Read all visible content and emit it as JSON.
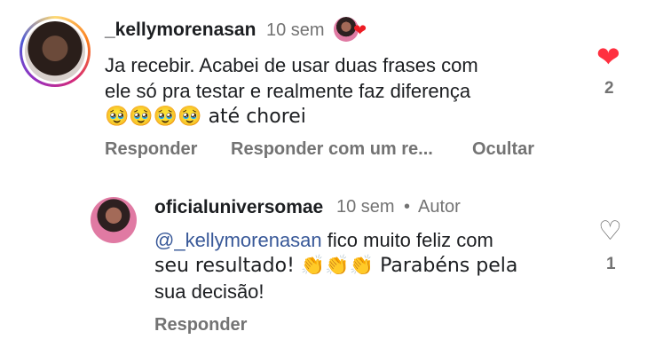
{
  "comments": [
    {
      "username": "_kellymorenasan",
      "time": "10 sem",
      "lines": [
        "Ja recebir. Acabei de usar duas frases com",
        "ele só pra testar e realmente faz diferença",
        "🥹🥹🥹🥹 até chorei"
      ],
      "actions": [
        "Responder",
        "Responder com um re...",
        "Ocultar"
      ],
      "likes": "2",
      "liked": true
    },
    {
      "username": "oficialuniversomae",
      "time": "10 sem",
      "separator": "•",
      "author_badge": "Autor",
      "mention": "@_kellymorenasan",
      "line1_rest": " fico muito feliz com",
      "line2": "seu resultado! 👏👏👏 Parabéns pela",
      "line3": "sua decisão!",
      "actions": [
        "Responder"
      ],
      "likes": "1",
      "liked": false
    }
  ],
  "icons": {
    "liked_heart": "heart-filled-icon",
    "like_heart": "heart-outline-icon",
    "creator_liked": "creator-liked-badge-icon"
  },
  "colors": {
    "like_red": "#ff3040",
    "mention_blue": "#385898",
    "meta_gray": "#737373"
  }
}
